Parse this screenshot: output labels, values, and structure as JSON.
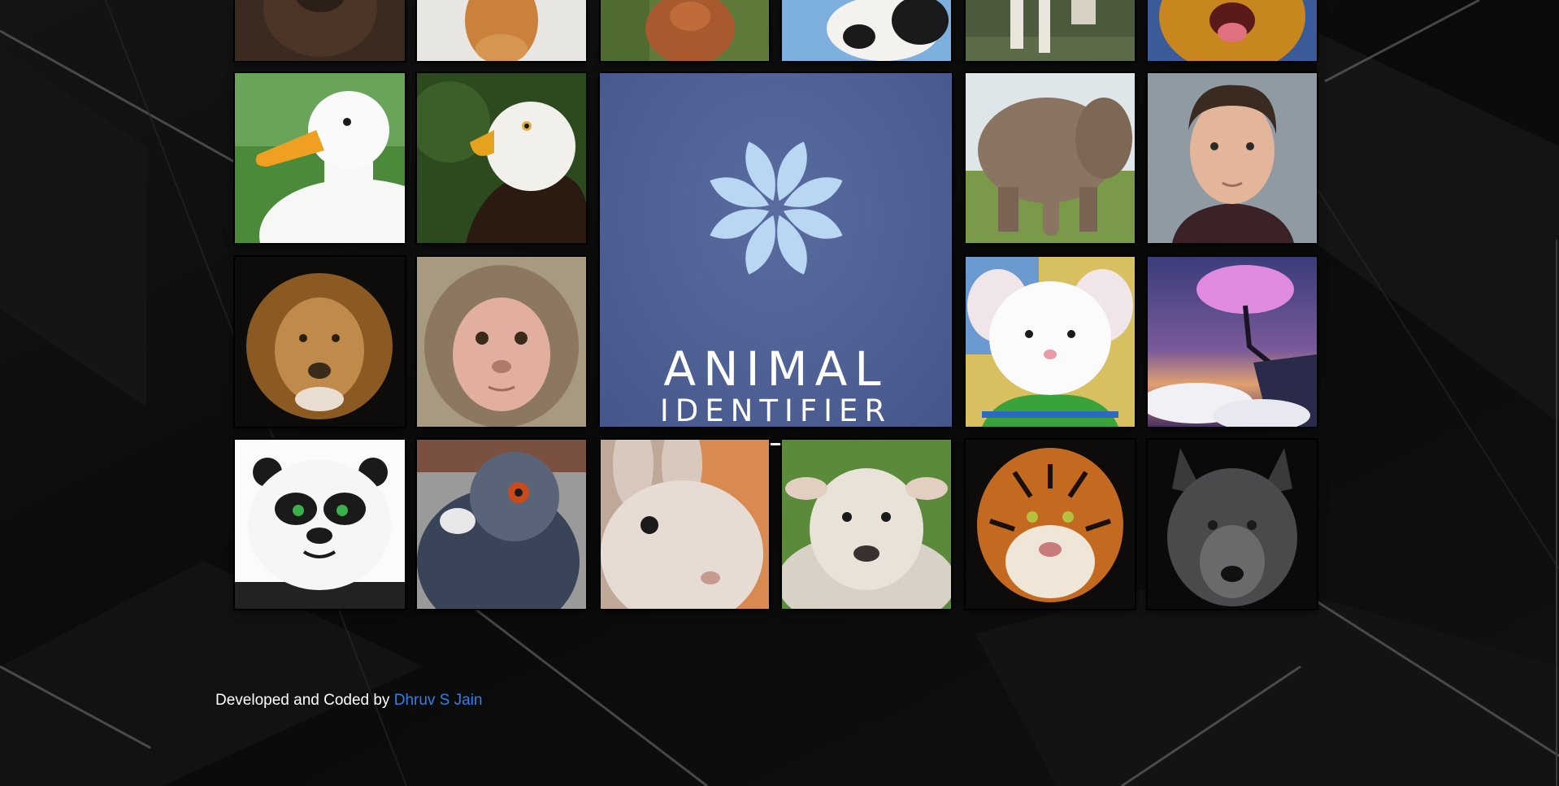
{
  "logo": {
    "title_line1": "ANIMAL",
    "title_line2": "IDENTIFIER",
    "background_color": "#5a6c9f"
  },
  "gallery": [
    {
      "name": "bear"
    },
    {
      "name": "cat"
    },
    {
      "name": "chicken"
    },
    {
      "name": "cow"
    },
    {
      "name": "horse"
    },
    {
      "name": "dog"
    },
    {
      "name": "duck"
    },
    {
      "name": "eagle"
    },
    {
      "name": "elephant"
    },
    {
      "name": "human"
    },
    {
      "name": "lion"
    },
    {
      "name": "monkey"
    },
    {
      "name": "mouse"
    },
    {
      "name": "tree"
    },
    {
      "name": "panda"
    },
    {
      "name": "pigeon"
    },
    {
      "name": "rabbit"
    },
    {
      "name": "sheep"
    },
    {
      "name": "tiger"
    },
    {
      "name": "wolf"
    }
  ],
  "footer": {
    "prefix": "Developed and Coded by",
    "author": "Dhruv S Jain",
    "author_color": "#2f7fe8"
  }
}
